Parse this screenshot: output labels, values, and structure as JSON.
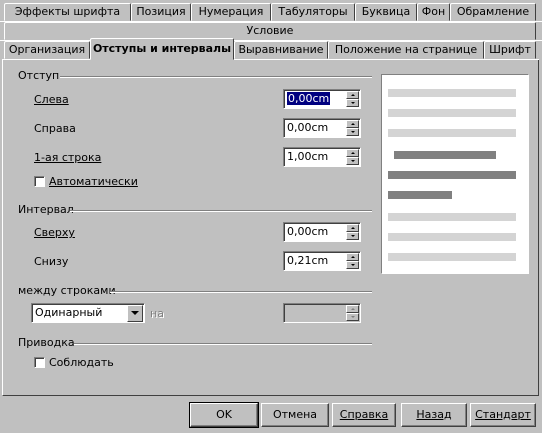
{
  "tabs_row1": [
    "Эффекты шрифта",
    "Позиция",
    "Нумерация",
    "Табуляторы",
    "Буквица",
    "Фон",
    "Обрамление"
  ],
  "tab_condition": "Условие",
  "tabs_row2": [
    "Организация",
    "Отступы и интервалы",
    "Выравнивание",
    "Положение на странице",
    "Шрифт"
  ],
  "indent": {
    "title": "Отступ",
    "left_label": "Слева",
    "left_value": "0,00cm",
    "right_label": "Справа",
    "right_value": "0,00cm",
    "first_line_label": "1-ая строка",
    "first_line_value": "1,00cm",
    "auto_label": "Автоматически"
  },
  "spacing": {
    "title": "Интервал",
    "above_label": "Сверху",
    "above_value": "0,00cm",
    "below_label": "Снизу",
    "below_value": "0,21cm"
  },
  "line_spacing": {
    "title": "между строками",
    "selected": "Одинарный",
    "of_label": "на",
    "of_value": ""
  },
  "register": {
    "title": "Приводка",
    "activate_label": "Соблюдать"
  },
  "buttons": {
    "ok": "OK",
    "cancel": "Отмена",
    "help": "Справка",
    "back": "Назад",
    "standard": "Стандарт"
  },
  "colors": {
    "dialog_bg": "#c0c0c0",
    "preview_light": "#d4d4d4",
    "preview_dark": "#808080",
    "selection": "#000080"
  }
}
